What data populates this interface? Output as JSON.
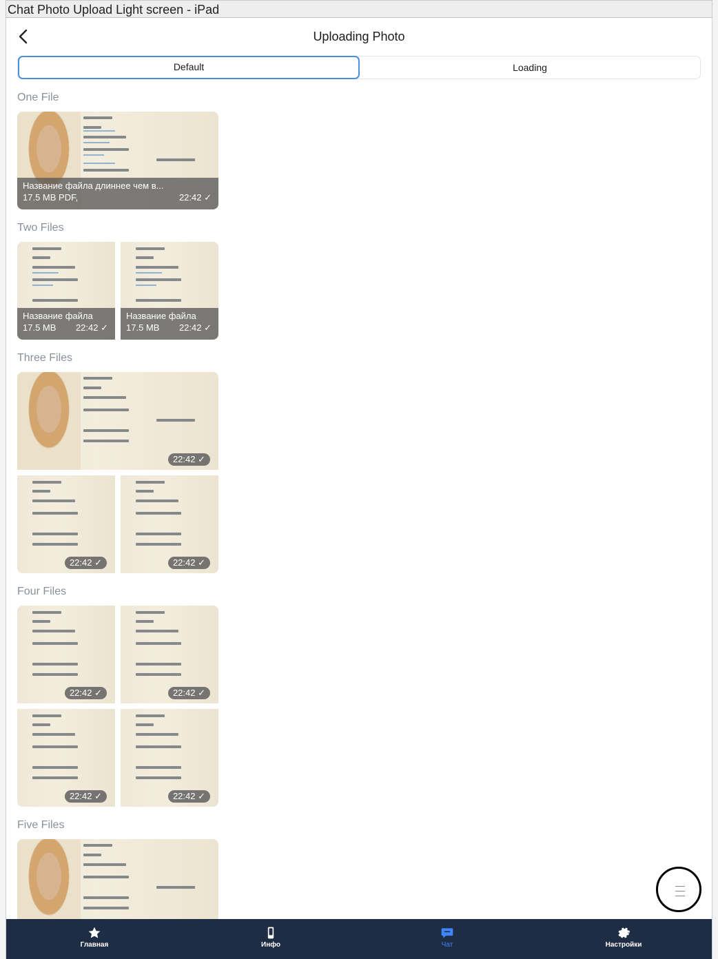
{
  "window": {
    "title": "Chat Photo Upload Light screen - iPad"
  },
  "header": {
    "title": "Uploading Photo"
  },
  "segmented": {
    "default": "Default",
    "loading": "Loading"
  },
  "sections": {
    "one": "One File",
    "two": "Two Files",
    "three": "Three Files",
    "four": "Four Files",
    "five": "Five Files"
  },
  "files": {
    "one_name": "Название файла длиннее чем в...",
    "one_meta": "17.5 MB PDF,",
    "short_name": "Название файла",
    "size": "17.5 MB",
    "time": "22:42"
  },
  "tabs": {
    "home": "Главная",
    "info": "Инфо",
    "chat": "Чат",
    "settings": "Настройки"
  },
  "colors": {
    "accent": "#4a90e2",
    "tabbar": "#1f2d44",
    "active_tab": "#3f86ff"
  }
}
